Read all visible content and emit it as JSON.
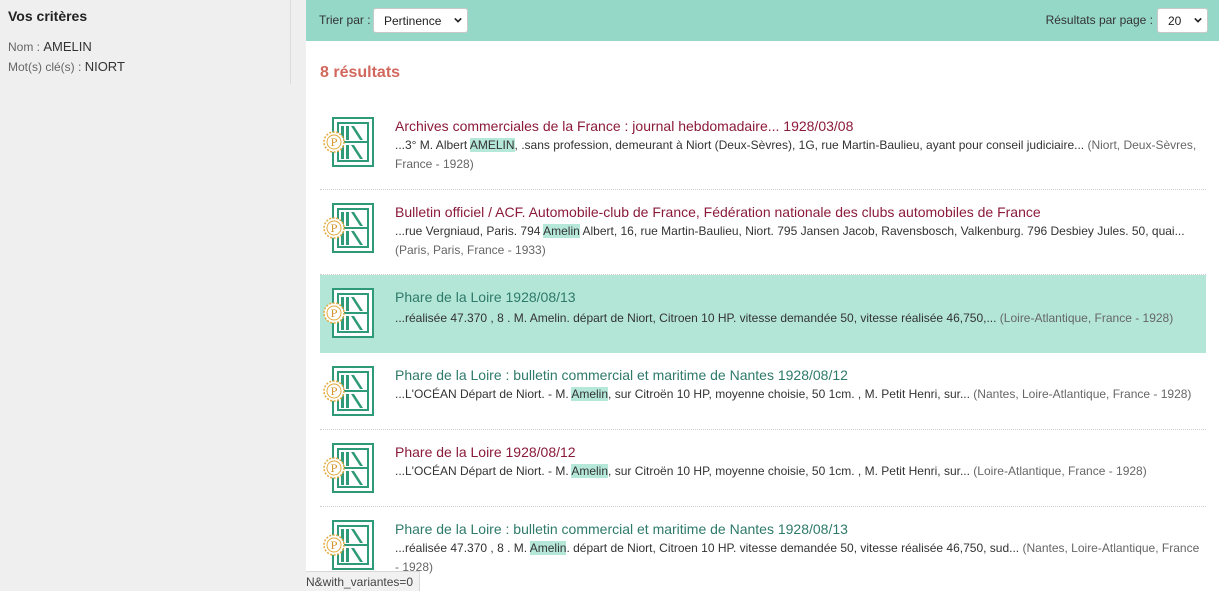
{
  "sidebar": {
    "title": "Vos critères",
    "criteria": [
      {
        "label": "Nom :",
        "value": "AMELIN"
      },
      {
        "label": "Mot(s) clé(s) :",
        "value": "NIORT"
      }
    ]
  },
  "toolbar": {
    "sort_label": "Trier par :",
    "sort_value": "Pertinence",
    "perpage_label": "Résultats par page :",
    "perpage_value": "20"
  },
  "results_count": "8 résultats",
  "results": [
    {
      "title": "Archives commerciales de la France : journal hebdomadaire... 1928/03/08",
      "pre": "...3° M. Albert ",
      "hl": "AMELIN",
      "post": ", .sans profession, demeurant à Niort (Deux-Sèvres), 1G, rue Martin-Baulieu, ayant pour conseil judiciaire...",
      "meta": " (Niort, Deux-Sèvres, France - 1928)"
    },
    {
      "title": "Bulletin officiel / ACF. Automobile-club de France, Fédération nationale des clubs automobiles de France",
      "pre": "...rue Vergniaud, Paris. 794 ",
      "hl": "Amelin",
      "post": " Albert, 16, rue Martin-Baulieu, Niort. 795 Jansen Jacob, Ravensbosch, Valkenburg. 796 Desbiey Jules. 50, quai...",
      "meta": " (Paris, Paris, France - 1933)"
    },
    {
      "title": "Phare de la Loire 1928/08/13",
      "pre": "...réalisée 47.370 , 8 . M. ",
      "hl": "Amelin",
      "post": ". départ de Niort, Citroen 10 HP. vitesse demandée 50, vitesse réalisée 46,750,...",
      "meta": " (Loire-Atlantique, France - 1928)"
    },
    {
      "title": "Phare de la Loire : bulletin commercial et maritime de Nantes 1928/08/12",
      "pre": "...L'OCÉAN Départ de Niort. - M. ",
      "hl": "Amelin",
      "post": ", sur Citroën 10 HP, moyenne choisie, 50 1cm. , M. Petit Henri, sur...",
      "meta": " (Nantes, Loire-Atlantique, France - 1928)"
    },
    {
      "title": "Phare de la Loire 1928/08/12",
      "pre": "...L'OCÉAN Départ de Niort. - M. ",
      "hl": "Amelin",
      "post": ", sur Citroën 10 HP, moyenne choisie, 50 1cm. , M. Petit Henri, sur...",
      "meta": " (Loire-Atlantique, France - 1928)"
    },
    {
      "title": "Phare de la Loire : bulletin commercial et maritime de Nantes 1928/08/13",
      "pre": "...réalisée 47.370 , 8 . M. ",
      "hl": "Amelin",
      "post": ". départ de Niort, Citroen 10 HP. vitesse demandée 50, vitesse réalisée 46,750, sud...",
      "meta": " (Nantes, Loire-Atlantique, France - 1928)"
    }
  ],
  "status_url": "N&with_variantes=0",
  "colors": {
    "toolbar": "#96d8c8",
    "highlight": "#b6e8d9",
    "title_red": "#8b1a3a",
    "title_teal": "#2e7a6a",
    "count": "#d2685d",
    "icon_green": "#2f9a77"
  },
  "icons": {
    "thumb": "press-document-icon",
    "badge": "press-badge-icon"
  }
}
